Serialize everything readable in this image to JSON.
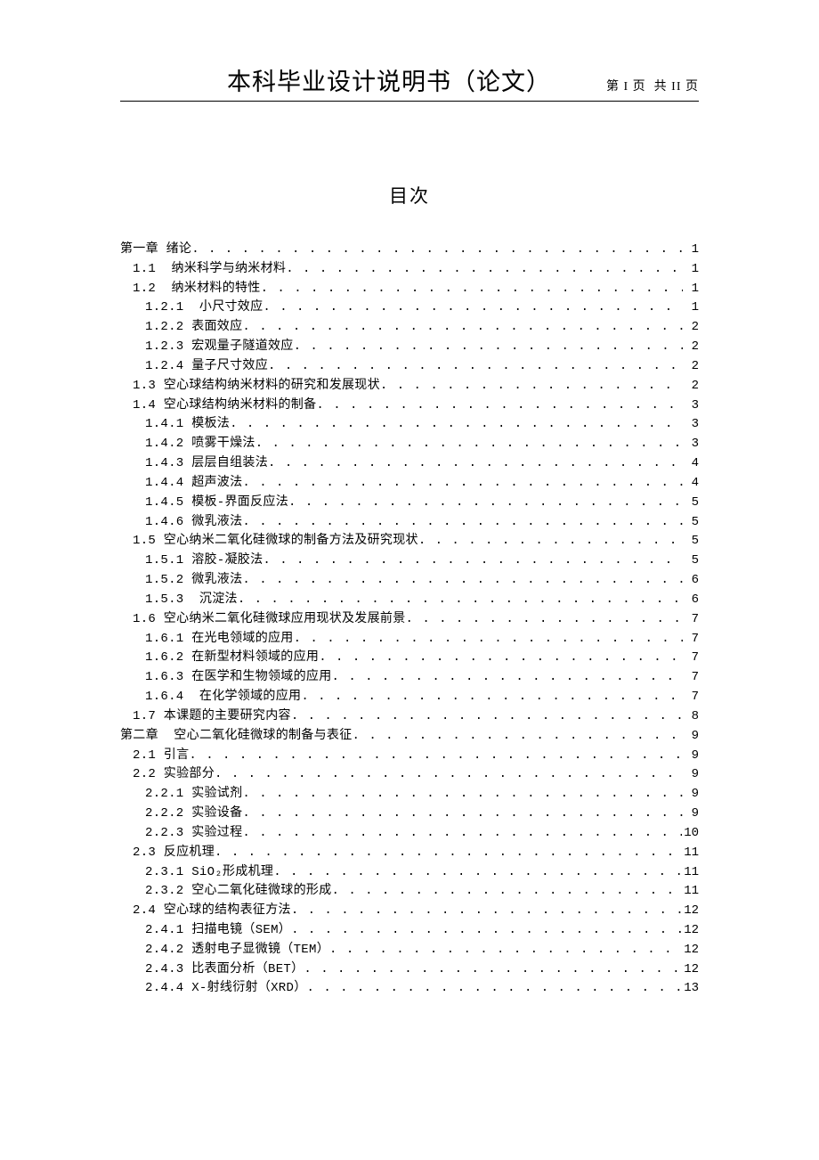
{
  "header": {
    "title": "本科毕业设计说明书（论文）",
    "page_indicator": "第 I 页  共 II 页"
  },
  "toc_heading": "目次",
  "toc": [
    {
      "label": "第一章 绪论 ",
      "page": "1",
      "level": 0
    },
    {
      "label": "1.1  纳米科学与纳米材料 ",
      "page": "1",
      "level": 1
    },
    {
      "label": "1.2  纳米材料的特性 ",
      "page": "1",
      "level": 1
    },
    {
      "label": "1.2.1  小尺寸效应 ",
      "page": "1",
      "level": 2
    },
    {
      "label": "1.2.2 表面效应 ",
      "page": "2",
      "level": 2
    },
    {
      "label": "1.2.3 宏观量子隧道效应 ",
      "page": "2",
      "level": 2
    },
    {
      "label": "1.2.4 量子尺寸效应 ",
      "page": "2",
      "level": 2
    },
    {
      "label": "1.3 空心球结构纳米材料的研究和发展现状 ",
      "page": "2",
      "level": 1
    },
    {
      "label": "1.4 空心球结构纳米材料的制备 ",
      "page": "3",
      "level": 1
    },
    {
      "label": "1.4.1 模板法 ",
      "page": "3",
      "level": 2
    },
    {
      "label": "1.4.2 喷雾干燥法 ",
      "page": "3",
      "level": 2
    },
    {
      "label": "1.4.3 层层自组装法 ",
      "page": "4",
      "level": 2
    },
    {
      "label": "1.4.4 超声波法 ",
      "page": "4",
      "level": 2
    },
    {
      "label": "1.4.5 模板-界面反应法 ",
      "page": "5",
      "level": 2
    },
    {
      "label": "1.4.6 微乳液法 ",
      "page": "5",
      "level": 2
    },
    {
      "label": "1.5 空心纳米二氧化硅微球的制备方法及研究现状 ",
      "page": "5",
      "level": 1
    },
    {
      "label": "1.5.1 溶胶-凝胶法 ",
      "page": "5",
      "level": 2
    },
    {
      "label": "1.5.2 微乳液法 ",
      "page": "6",
      "level": 2
    },
    {
      "label": "1.5.3  沉淀法 ",
      "page": "6",
      "level": 2
    },
    {
      "label": "1.6 空心纳米二氧化硅微球应用现状及发展前景 ",
      "page": "7",
      "level": 1
    },
    {
      "label": "1.6.1 在光电领域的应用 ",
      "page": "7",
      "level": 2
    },
    {
      "label": "1.6.2 在新型材料领域的应用 ",
      "page": "7",
      "level": 2
    },
    {
      "label": "1.6.3 在医学和生物领域的应用 ",
      "page": "7",
      "level": 2
    },
    {
      "label": "1.6.4  在化学领域的应用 ",
      "page": "7",
      "level": 2
    },
    {
      "label": "1.7 本课题的主要研究内容 ",
      "page": "8",
      "level": 1
    },
    {
      "label": "第二章  空心二氧化硅微球的制备与表征 ",
      "page": "9",
      "level": 0
    },
    {
      "label": "2.1 引言 ",
      "page": "9",
      "level": 1
    },
    {
      "label": "2.2 实验部分 ",
      "page": "9",
      "level": 1
    },
    {
      "label": "2.2.1 实验试剂 ",
      "page": "9",
      "level": 2
    },
    {
      "label": "2.2.2 实验设备 ",
      "page": "9",
      "level": 2
    },
    {
      "label": "2.2.3 实验过程 ",
      "page": "10",
      "level": 2
    },
    {
      "label": "2.3 反应机理 ",
      "page": "11",
      "level": 1
    },
    {
      "label": "2.3.1 SiO₂形成机理 ",
      "page": "11",
      "level": 2
    },
    {
      "label": "2.3.2 空心二氧化硅微球的形成 ",
      "page": "11",
      "level": 2
    },
    {
      "label": "2.4 空心球的结构表征方法 ",
      "page": "12",
      "level": 1
    },
    {
      "label": "2.4.1 扫描电镜（SEM） ",
      "page": "12",
      "level": 2
    },
    {
      "label": "2.4.2 透射电子显微镜（TEM） ",
      "page": "12",
      "level": 2
    },
    {
      "label": "2.4.3 比表面分析（BET） ",
      "page": "12",
      "level": 2
    },
    {
      "label": "2.4.4 X-射线衍射（XRD） ",
      "page": "13",
      "level": 2
    }
  ]
}
